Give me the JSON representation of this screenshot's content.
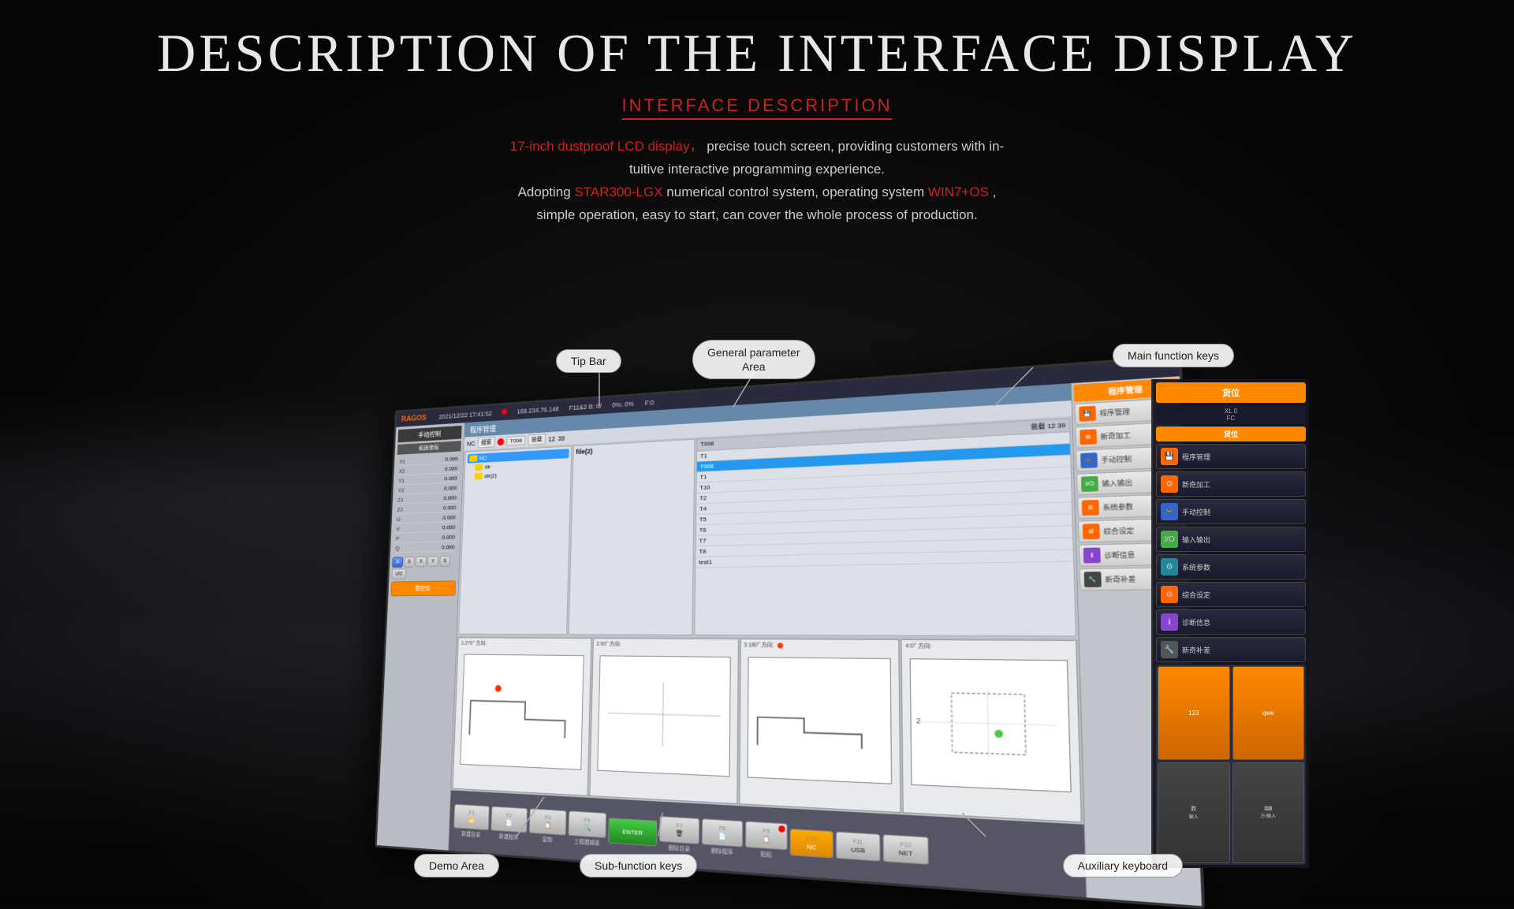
{
  "page": {
    "main_title": "DESCRIPTION OF THE INTERFACE DISPLAY",
    "sub_title": "INTERFACE DESCRIPTION",
    "description_line1_plain": "precise touch screen, providing customers with in-",
    "description_line1_red": "17-inch dustproof LCD display，",
    "description_line2": "tuitive interactive programming experience.",
    "description_line3_plain1": "Adopting ",
    "description_line3_red1": "STAR300-LGX",
    "description_line3_plain2": " numerical control system, operating system ",
    "description_line3_red2": "WIN7+OS",
    "description_line3_plain3": ",",
    "description_line4": "simple operation, easy to start, can cover the whole process of production."
  },
  "labels": {
    "tip_bar": "Tip Bar",
    "general_parameter": "General parameter\nArea",
    "main_function_keys": "Main function keys",
    "demo_area": "Demo Area",
    "sub_function_keys": "Sub-function keys",
    "auxiliary_keyboard": "Auxiliary keyboard"
  },
  "screen": {
    "logo": "RAGOS",
    "status_bar": {
      "time": "2021/12/22 17:41:52",
      "ip": "169.234.76.148",
      "file": "F11&2 B: 0/",
      "status": "0%: 0%",
      "extra": "F:0"
    },
    "left_panel": {
      "title": "手动控制",
      "subtitle": "机床坐标",
      "coords": [
        {
          "axis": "X1",
          "value": "0.000"
        },
        {
          "axis": "X2",
          "value": "0.000"
        },
        {
          "axis": "Y1",
          "value": "0.000"
        },
        {
          "axis": "Y2",
          "value": "0.000"
        },
        {
          "axis": "Z1",
          "value": "0.000"
        },
        {
          "axis": "Z2",
          "value": "0.000"
        },
        {
          "axis": "U",
          "value": "0.000"
        },
        {
          "axis": "V",
          "value": "0.000"
        },
        {
          "axis": "P",
          "value": "0.000"
        },
        {
          "axis": "Q",
          "value": "0.000"
        }
      ],
      "buttons": [
        "A",
        "S",
        "X",
        "Y",
        "S",
        "U/2"
      ],
      "bottom_label": "数控走"
    },
    "program_title": "程序管理",
    "file_toolbar": {
      "nc_label": "NC",
      "search_label": "搜索",
      "t_label": "T008",
      "b_label": "装载",
      "num": "12",
      "extra": "39"
    },
    "file_tree": {
      "items": [
        {
          "name": "NC",
          "type": "folder",
          "selected": true
        },
        {
          "name": "dir",
          "type": "folder"
        },
        {
          "name": "dir(2)",
          "type": "folder"
        }
      ]
    },
    "file_list": {
      "header": "file(2)",
      "items": []
    },
    "tool_list": {
      "header_left": "T008",
      "header_right": "装载 12 39",
      "items": [
        {
          "name": "T1",
          "selected": false
        },
        {
          "name": "T008",
          "selected": true
        },
        {
          "name": "T1",
          "selected": false
        },
        {
          "name": "T10",
          "selected": false
        },
        {
          "name": "T2",
          "selected": false
        },
        {
          "name": "T4",
          "selected": false
        },
        {
          "name": "T5",
          "selected": false
        },
        {
          "name": "T6",
          "selected": false
        },
        {
          "name": "T7",
          "selected": false
        },
        {
          "name": "T8",
          "selected": false
        },
        {
          "name": "test1",
          "selected": false
        }
      ]
    },
    "views": [
      {
        "label": "1:270° 方向:"
      },
      {
        "label": "2:90° 方向:"
      },
      {
        "label": "3:180° 方向:"
      },
      {
        "label": "4:0° 方向:"
      }
    ],
    "fn_keys": [
      {
        "num": "F1",
        "icon": "📁",
        "label": "新建目录"
      },
      {
        "num": "F2",
        "icon": "📄",
        "label": "新建程序"
      },
      {
        "num": "F3",
        "icon": "📋",
        "label": "复制"
      },
      {
        "num": "F4",
        "icon": "🔍",
        "label": "工程图链接"
      },
      {
        "num": "",
        "icon": "ENTER",
        "label": ""
      },
      {
        "num": "F7",
        "icon": "🗑",
        "label": "删除目录"
      },
      {
        "num": "F8",
        "icon": "📄",
        "label": "删除程序"
      },
      {
        "num": "F9",
        "icon": "📋",
        "label": "粘贴"
      },
      {
        "num": "F10",
        "icon": "NC",
        "label": ""
      },
      {
        "num": "F11",
        "icon": "USB",
        "label": ""
      },
      {
        "num": "F12",
        "icon": "NET",
        "label": ""
      }
    ],
    "right_buttons": [
      {
        "icon": "💾",
        "label": "程序管理",
        "color": "orange"
      },
      {
        "icon": "⚙",
        "label": "新奇加工",
        "color": "orange"
      },
      {
        "icon": "🎮",
        "label": "手动控制",
        "color": "blue"
      },
      {
        "icon": "I/O",
        "label": "输入输出",
        "color": "green"
      },
      {
        "icon": "⚙",
        "label": "系统参数",
        "color": "orange"
      },
      {
        "icon": "⚙",
        "label": "综合设定",
        "color": "orange"
      },
      {
        "icon": "ℹ",
        "label": "诊断信息",
        "color": "purple"
      },
      {
        "icon": "🔧",
        "label": "新奇补差",
        "color": "dark"
      }
    ],
    "far_right_buttons": [
      {
        "icon": "💾",
        "label": "程序管理",
        "color": "orange"
      },
      {
        "icon": "⚙",
        "label": "新奇加工",
        "color": "orange"
      },
      {
        "icon": "🎮",
        "label": "手动控制",
        "color": "blue"
      },
      {
        "icon": "I/O",
        "label": "输入输出",
        "color": "green"
      },
      {
        "icon": "⚙",
        "label": "系统参数",
        "color": "teal"
      },
      {
        "icon": "⚙",
        "label": "综合设定",
        "color": "orange"
      },
      {
        "icon": "ℹ",
        "label": "诊断信息",
        "color": "purple"
      },
      {
        "icon": "🔧",
        "label": "新奇补差",
        "color": "dark"
      }
    ],
    "aux_keys": [
      {
        "label": "123"
      },
      {
        "label": "qwe"
      },
      {
        "label": "数",
        "sub": "输入"
      },
      {
        "label": "⌨",
        "sub": "方/输入"
      }
    ]
  }
}
